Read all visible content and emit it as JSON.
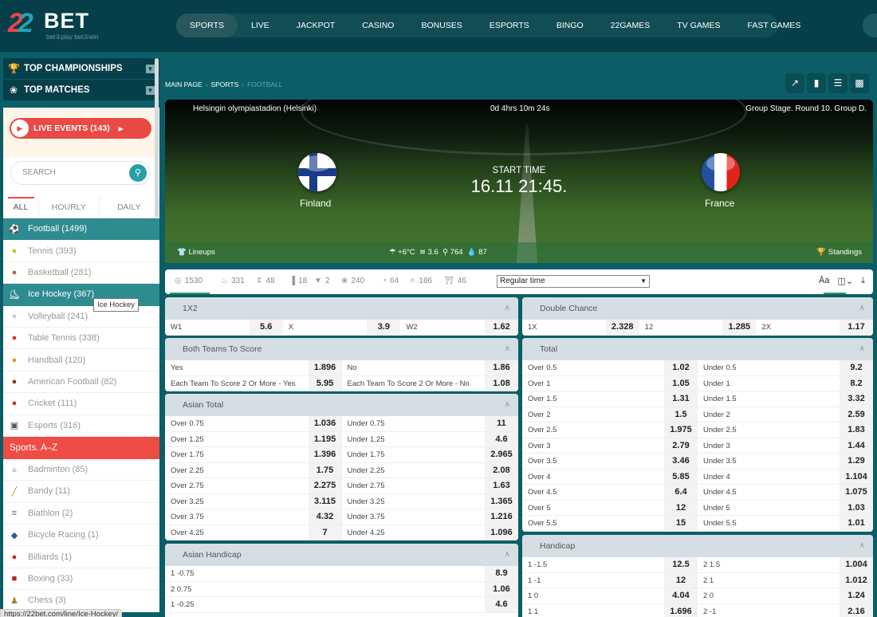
{
  "header": {
    "logo_num": "22",
    "logo_text": "BET",
    "logo_tagline": "bet②play  bet②win",
    "nav": [
      {
        "label": "SPORTS",
        "active": true
      },
      {
        "label": "LIVE"
      },
      {
        "label": "JACKPOT"
      },
      {
        "label": "CASINO"
      },
      {
        "label": "BONUSES"
      },
      {
        "label": "ESPORTS"
      },
      {
        "label": "BINGO"
      },
      {
        "label": "22GAMES"
      },
      {
        "label": "TV GAMES"
      },
      {
        "label": "FAST GAMES"
      }
    ]
  },
  "sidebar": {
    "top_championships": "TOP CHAMPIONSHIPS",
    "top_matches": "TOP MATCHES",
    "live_events": "LIVE EVENTS (143)",
    "search_placeholder": "SEARCH",
    "tabs": [
      "ALL",
      "HOURLY",
      "DAILY"
    ],
    "sports": [
      {
        "label": "Football (1499)",
        "icon": "⚽",
        "selected": true
      },
      {
        "label": "Tennis (393)",
        "icon": "●",
        "color": "#b8c832"
      },
      {
        "label": "Basketball (281)",
        "icon": "●",
        "color": "#c0602a"
      },
      {
        "label": "Ice Hockey (367)",
        "icon": "⛸",
        "selected": true
      },
      {
        "label": "Volleyball (241)",
        "icon": "●",
        "color": "#ccc"
      },
      {
        "label": "Table Tennis (338)",
        "icon": "●",
        "color": "#e0302a"
      },
      {
        "label": "Handball (120)",
        "icon": "●",
        "color": "#e0902a"
      },
      {
        "label": "American Football (82)",
        "icon": "●",
        "color": "#7a4020"
      },
      {
        "label": "Cricket (111)",
        "icon": "●",
        "color": "#c03030"
      },
      {
        "label": "Esports (316)",
        "icon": "▣",
        "color": "#555"
      }
    ],
    "az_header": "Sports. A–Z",
    "az_sports": [
      {
        "label": "Badminton (85)",
        "icon": "▲",
        "color": "#ccc"
      },
      {
        "label": "Bandy (11)",
        "icon": "╱",
        "color": "#d08030"
      },
      {
        "label": "Biathlon (2)",
        "icon": "≡",
        "color": "#666"
      },
      {
        "label": "Bicycle Racing (1)",
        "icon": "◆",
        "color": "#2a5a9a"
      },
      {
        "label": "Billiards (1)",
        "icon": "●",
        "color": "#d02020"
      },
      {
        "label": "Boxing (33)",
        "icon": "■",
        "color": "#c02020"
      },
      {
        "label": "Chess (3)",
        "icon": "♟",
        "color": "#b08020"
      }
    ],
    "tooltip": "Ice Hockey",
    "status_url": "https://22bet.com/line/Ice-Hockey/"
  },
  "breadcrumb": [
    "MAIN PAGE",
    "SPORTS",
    "FOOTBALL"
  ],
  "match": {
    "venue": "Helsingin olympiastadion (Helsinki)",
    "countdown": "0d 4hrs 10m 24s",
    "stage": "Group Stage. Round 10. Group D.",
    "team1": "Finland",
    "team2": "France",
    "start_label": "START TIME",
    "start_time": "16.11 21:45.",
    "lineups": "Lineups",
    "weather": "+6°C",
    "wind": "3.6",
    "pressure": "764",
    "humidity": "87",
    "standings": "Standings"
  },
  "filters": {
    "counts": [
      {
        "icon": "◎",
        "value": "1530"
      },
      {
        "icon": "♨",
        "value": "331"
      },
      {
        "icon": "⇕",
        "value": "48"
      },
      {
        "icon": "▐",
        "value": "18"
      },
      {
        "icon": "▼",
        "value": "2"
      },
      {
        "icon": "❀",
        "value": "240"
      },
      {
        "icon": "◔",
        "value": "64"
      },
      {
        "icon": "✧",
        "value": "186"
      },
      {
        "icon": "⛩",
        "value": "46"
      }
    ],
    "period_select": "Regular time"
  },
  "markets": {
    "x12": {
      "title": "1X2",
      "cells": [
        [
          "W1",
          "5.6"
        ],
        [
          "X",
          "3.9"
        ],
        [
          "W2",
          "1.62"
        ]
      ]
    },
    "double_chance": {
      "title": "Double Chance",
      "cells": [
        [
          "1X",
          "2.328"
        ],
        [
          "12",
          "1.285"
        ],
        [
          "2X",
          "1.17"
        ]
      ]
    },
    "btts": {
      "title": "Both Teams To Score",
      "rows": [
        [
          [
            "Yes",
            "1.896"
          ],
          [
            "No",
            "1.86"
          ]
        ],
        [
          [
            "Each Team To Score 2 Or More - Yes",
            "5.95"
          ],
          [
            "Each Team To Score 2 Or More - No",
            "1.08"
          ]
        ]
      ]
    },
    "total": {
      "title": "Total",
      "rows": [
        [
          [
            "Over 0.5",
            "1.02"
          ],
          [
            "Under 0.5",
            "9.2"
          ]
        ],
        [
          [
            "Over 1",
            "1.05"
          ],
          [
            "Under 1",
            "8.2"
          ]
        ],
        [
          [
            "Over 1.5",
            "1.31"
          ],
          [
            "Under 1.5",
            "3.32"
          ]
        ],
        [
          [
            "Over 2",
            "1.5"
          ],
          [
            "Under 2",
            "2.59"
          ]
        ],
        [
          [
            "Over 2.5",
            "1.975"
          ],
          [
            "Under 2.5",
            "1.83"
          ]
        ],
        [
          [
            "Over 3",
            "2.79"
          ],
          [
            "Under 3",
            "1.44"
          ]
        ],
        [
          [
            "Over 3.5",
            "3.46"
          ],
          [
            "Under 3.5",
            "1.29"
          ]
        ],
        [
          [
            "Over 4",
            "5.85"
          ],
          [
            "Under 4",
            "1.104"
          ]
        ],
        [
          [
            "Over 4.5",
            "6.4"
          ],
          [
            "Under 4.5",
            "1.075"
          ]
        ],
        [
          [
            "Over 5",
            "12"
          ],
          [
            "Under 5",
            "1.03"
          ]
        ],
        [
          [
            "Over 5.5",
            "15"
          ],
          [
            "Under 5.5",
            "1.01"
          ]
        ]
      ]
    },
    "asian_total": {
      "title": "Asian Total",
      "rows": [
        [
          [
            "Over 0.75",
            "1.036"
          ],
          [
            "Under 0.75",
            "11"
          ]
        ],
        [
          [
            "Over 1.25",
            "1.195"
          ],
          [
            "Under 1.25",
            "4.6"
          ]
        ],
        [
          [
            "Over 1.75",
            "1.396"
          ],
          [
            "Under 1.75",
            "2.965"
          ]
        ],
        [
          [
            "Over 2.25",
            "1.75"
          ],
          [
            "Under 2.25",
            "2.08"
          ]
        ],
        [
          [
            "Over 2.75",
            "2.275"
          ],
          [
            "Under 2.75",
            "1.63"
          ]
        ],
        [
          [
            "Over 3.25",
            "3.115"
          ],
          [
            "Under 3.25",
            "1.365"
          ]
        ],
        [
          [
            "Over 3.75",
            "4.32"
          ],
          [
            "Under 3.75",
            "1.216"
          ]
        ],
        [
          [
            "Over 4.25",
            "7"
          ],
          [
            "Under 4.25",
            "1.096"
          ]
        ]
      ]
    },
    "asian_handicap": {
      "title": "Asian Handicap",
      "rows": [
        [
          [
            "1 -0.75",
            "8.9"
          ]
        ],
        [
          [
            "2 0.75",
            "1.06"
          ]
        ],
        [
          [
            "1 -0.25",
            "4.6"
          ]
        ]
      ]
    },
    "handicap": {
      "title": "Handicap",
      "rows": [
        [
          [
            "1 -1.5",
            "12.5"
          ],
          [
            "2 1.5",
            "1.004"
          ]
        ],
        [
          [
            "1 -1",
            "12"
          ],
          [
            "2 1",
            "1.012"
          ]
        ],
        [
          [
            "1 0",
            "4.04"
          ],
          [
            "2 0",
            "1.24"
          ]
        ],
        [
          [
            "1 1",
            "1.696"
          ],
          [
            "2 -1",
            "2.16"
          ]
        ]
      ]
    }
  }
}
